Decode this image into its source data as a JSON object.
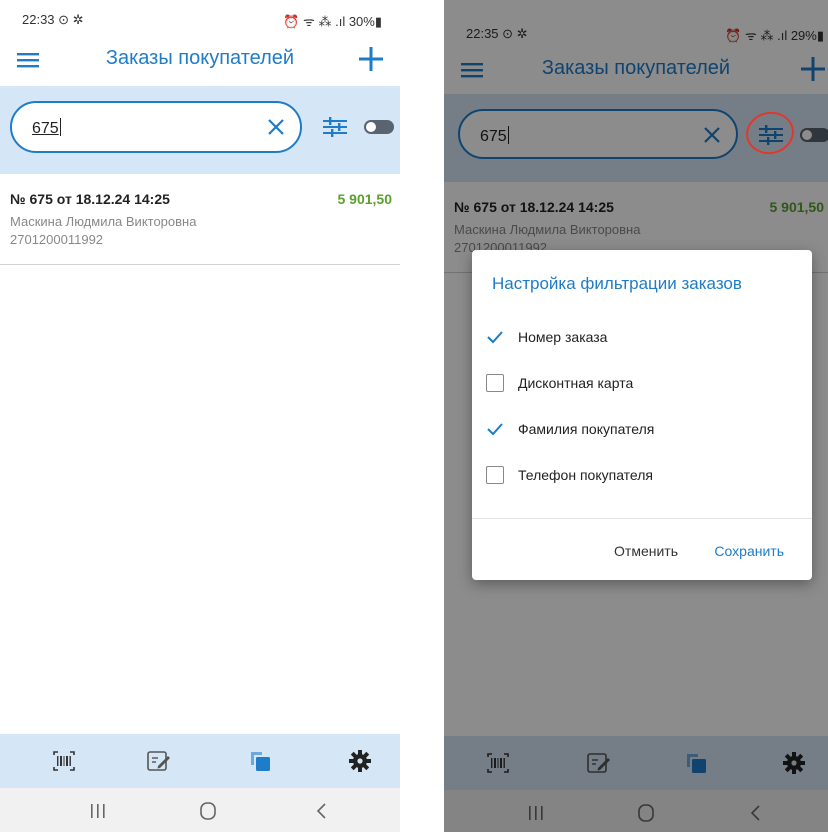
{
  "left": {
    "status": {
      "time": "22:33 ⊙ ✲",
      "right": "⏰ ᯤ ⁂ .ıl 30%▮"
    },
    "title": "Заказы покупателей",
    "search": {
      "value": "675"
    },
    "order": {
      "number": "№ 675 от 18.12.24 14:25",
      "sum": "5 901,50",
      "customer": "Маскина Людмила Викторовна",
      "card": "2701200011992"
    }
  },
  "right": {
    "status": {
      "time": "22:35 ⊙ ✲",
      "right": "⏰ ᯤ ⁂ .ıl 29%▮"
    },
    "title": "Заказы покупателей",
    "search": {
      "value": "675"
    },
    "order": {
      "number": "№ 675 от 18.12.24 14:25",
      "sum": "5 901,50",
      "customer": "Маскина Людмила Викторовна",
      "card": "2701200011992"
    },
    "dialog": {
      "title": "Настройка фильтрации заказов",
      "options": [
        {
          "label": "Номер заказа",
          "checked": true
        },
        {
          "label": "Дисконтная карта",
          "checked": false
        },
        {
          "label": "Фамилия покупателя",
          "checked": true
        },
        {
          "label": "Телефон покупателя",
          "checked": false
        }
      ],
      "cancel": "Отменить",
      "save": "Сохранить"
    }
  },
  "colors": {
    "accent": "#1e7cc8",
    "band": "#d5e6f6",
    "sum": "#5aa02c",
    "annotation": "#e0392b"
  },
  "icons": [
    "menu-icon",
    "plus-icon",
    "clear-icon",
    "filter-settings-icon",
    "toggle-switch",
    "barcode-scan-icon",
    "edit-note-icon",
    "copy-icon",
    "gear-icon",
    "recent-apps-icon",
    "home-icon",
    "back-icon"
  ]
}
